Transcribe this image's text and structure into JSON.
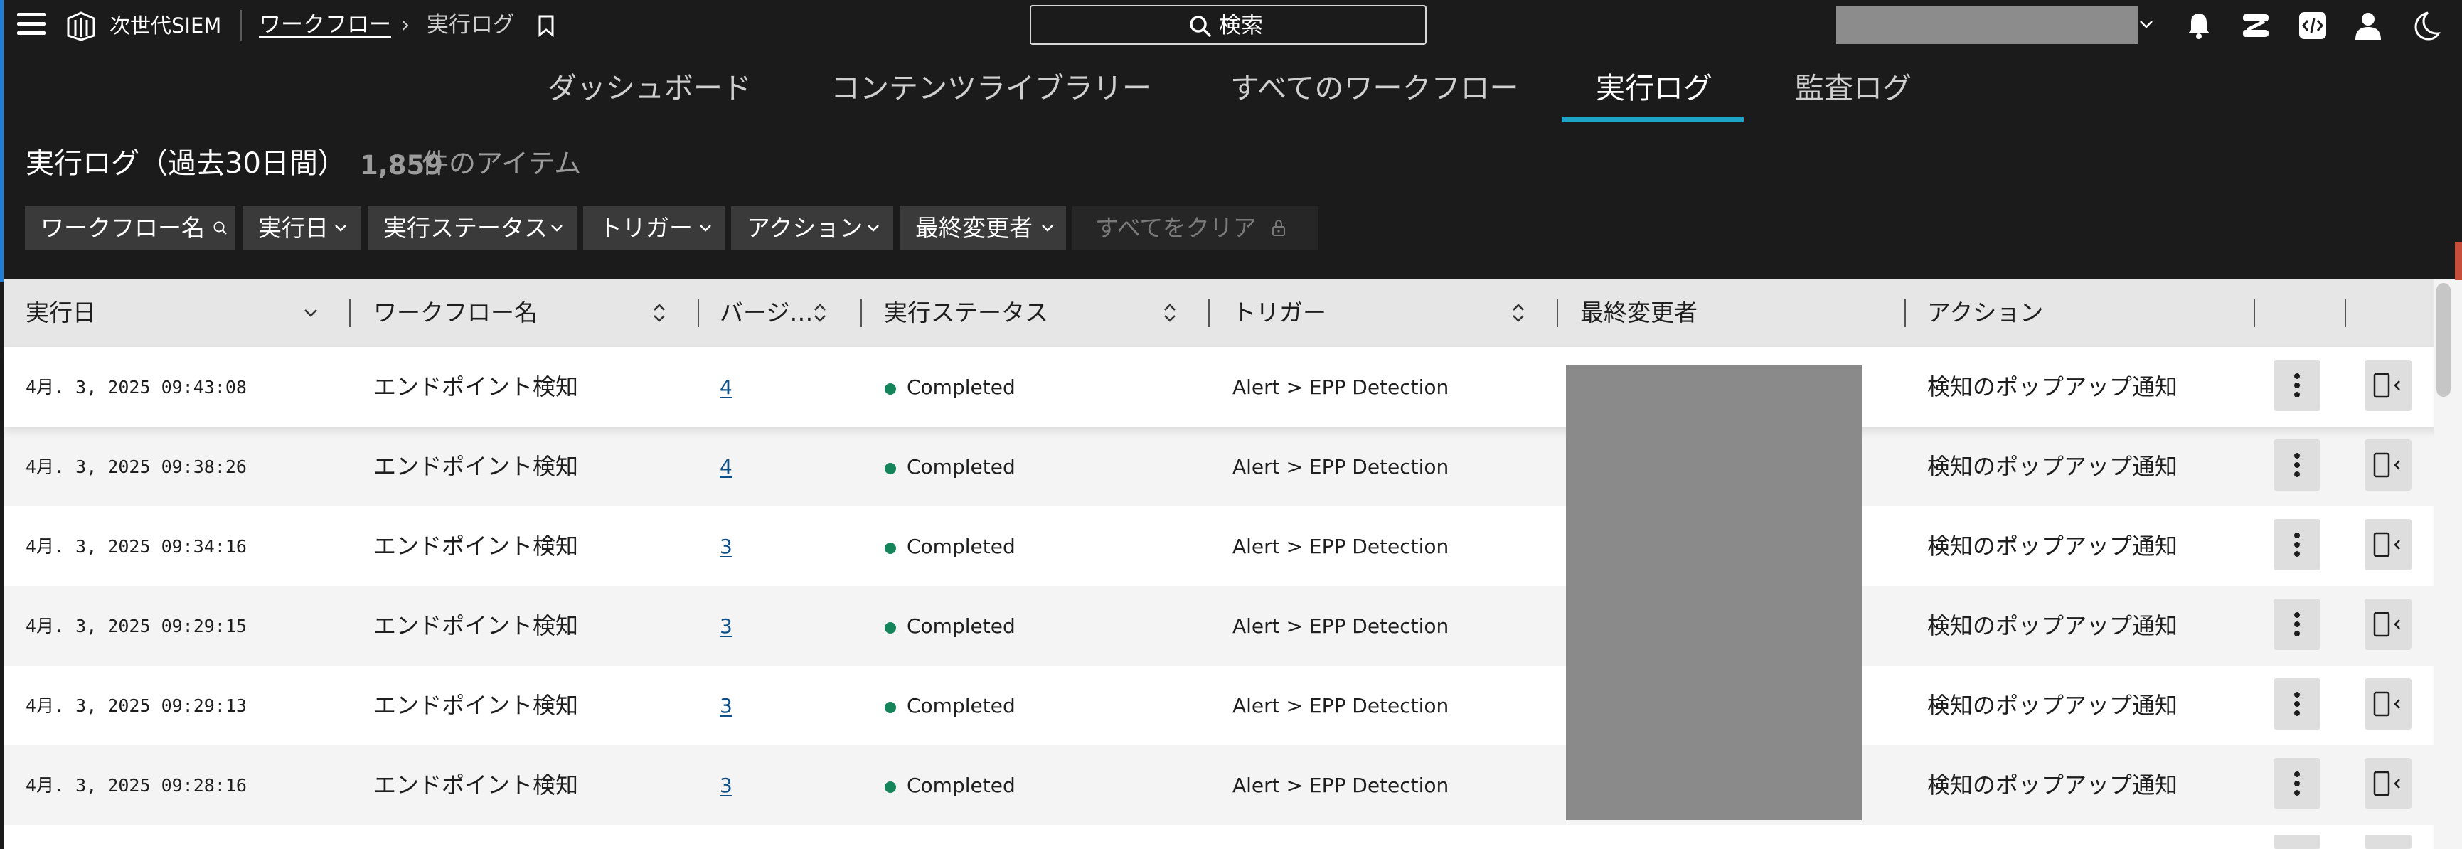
{
  "header": {
    "app_title": "次世代SIEM",
    "breadcrumb": {
      "parent": "ワークフロー",
      "separator": "›",
      "current": "実行ログ"
    },
    "search": {
      "label": "検索"
    },
    "icons": [
      "menu-icon",
      "logo-icon",
      "bookmark-icon",
      "search-icon",
      "chevron-down-icon",
      "bell-icon",
      "graph-icon",
      "code-icon",
      "user-icon",
      "moon-icon"
    ]
  },
  "tabs": [
    {
      "label": "ダッシュボード",
      "active": false
    },
    {
      "label": "コンテンツライブラリー",
      "active": false
    },
    {
      "label": "すべてのワークフロー",
      "active": false
    },
    {
      "label": "実行ログ",
      "active": true
    },
    {
      "label": "監査ログ",
      "active": false
    }
  ],
  "page": {
    "heading": "実行ログ（過去30日間）",
    "count_number": "1,859",
    "count_suffix": "件のアイテム"
  },
  "filters": {
    "workflow_name": "ワークフロー名",
    "exec_date": "実行日",
    "exec_status": "実行ステータス",
    "trigger": "トリガー",
    "action": "アクション",
    "last_modified_by": "最終変更者",
    "clear_all": "すべてをクリア"
  },
  "table": {
    "columns": {
      "exec_date": "実行日",
      "workflow_name": "ワークフロー名",
      "version": "バージ…",
      "exec_status": "実行ステータス",
      "trigger": "トリガー",
      "last_modified_by": "最終変更者",
      "action": "アクション"
    },
    "rows": [
      {
        "date": "4月. 3, 2025 09:43:08",
        "workflow": "エンドポイント検知",
        "version": "4",
        "status": "Completed",
        "trigger": "Alert > EPP Detection",
        "action": "検知のポップアップ通知"
      },
      {
        "date": "4月. 3, 2025 09:38:26",
        "workflow": "エンドポイント検知",
        "version": "4",
        "status": "Completed",
        "trigger": "Alert > EPP Detection",
        "action": "検知のポップアップ通知"
      },
      {
        "date": "4月. 3, 2025 09:34:16",
        "workflow": "エンドポイント検知",
        "version": "3",
        "status": "Completed",
        "trigger": "Alert > EPP Detection",
        "action": "検知のポップアップ通知"
      },
      {
        "date": "4月. 3, 2025 09:29:15",
        "workflow": "エンドポイント検知",
        "version": "3",
        "status": "Completed",
        "trigger": "Alert > EPP Detection",
        "action": "検知のポップアップ通知"
      },
      {
        "date": "4月. 3, 2025 09:29:13",
        "workflow": "エンドポイント検知",
        "version": "3",
        "status": "Completed",
        "trigger": "Alert > EPP Detection",
        "action": "検知のポップアップ通知"
      },
      {
        "date": "4月. 3, 2025 09:28:16",
        "workflow": "エンドポイント検知",
        "version": "3",
        "status": "Completed",
        "trigger": "Alert > EPP Detection",
        "action": "検知のポップアップ通知"
      }
    ]
  },
  "colors": {
    "topbar_bg": "#1b1b1b",
    "tab_active_underline": "#1fa3c7",
    "status_completed": "#14855b",
    "version_link": "#0d4f86",
    "left_accent": "#1f7fd8"
  }
}
